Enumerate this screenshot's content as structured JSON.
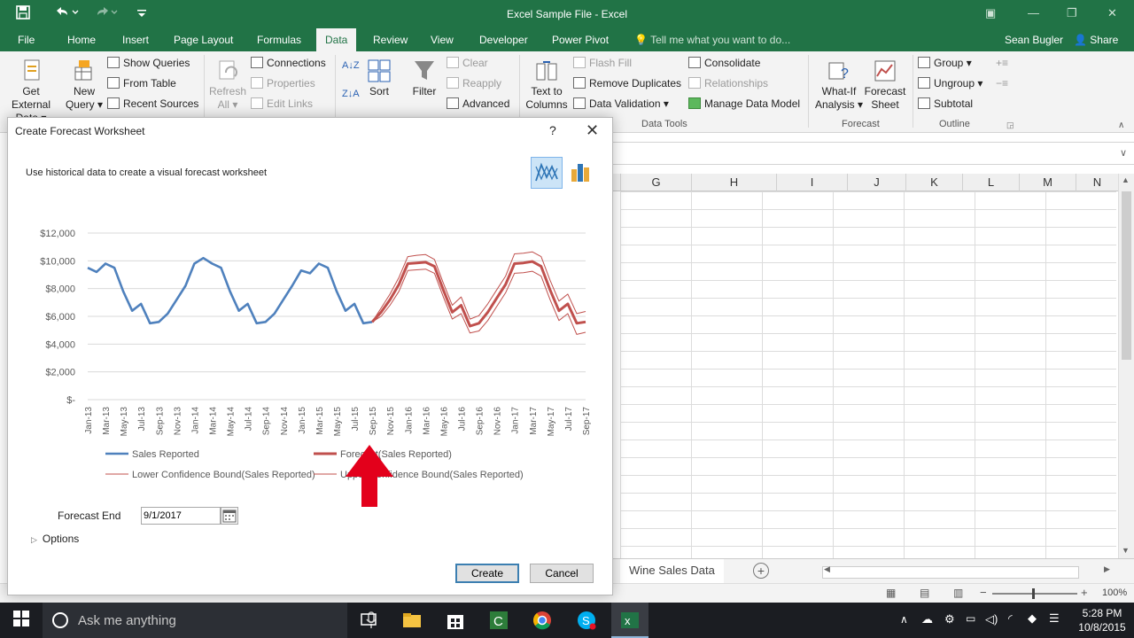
{
  "window": {
    "title": "Excel Sample File - Excel"
  },
  "tabs": [
    {
      "label": "File"
    },
    {
      "label": "Home"
    },
    {
      "label": "Insert"
    },
    {
      "label": "Page Layout"
    },
    {
      "label": "Formulas"
    },
    {
      "label": "Data"
    },
    {
      "label": "Review"
    },
    {
      "label": "View"
    },
    {
      "label": "Developer"
    },
    {
      "label": "Power Pivot"
    }
  ],
  "tell_me": "Tell me what you want to do...",
  "user": "Sean Bugler",
  "share": "Share",
  "ribbon": {
    "get_external": "Get External",
    "get_external_2": "Data",
    "new_query": "New",
    "new_query_2": "Query",
    "show_queries": "Show Queries",
    "from_table": "From Table",
    "recent_sources": "Recent Sources",
    "refresh": "Refresh",
    "refresh_2": "All",
    "connections": "Connections",
    "properties": "Properties",
    "edit_links": "Edit Links",
    "sort": "Sort",
    "filter": "Filter",
    "clear": "Clear",
    "reapply": "Reapply",
    "advanced": "Advanced",
    "text_to_columns": "Text to",
    "text_to_columns_2": "Columns",
    "flash_fill": "Flash Fill",
    "remove_duplicates": "Remove Duplicates",
    "data_validation": "Data Validation",
    "consolidate": "Consolidate",
    "relationships": "Relationships",
    "manage_data_model": "Manage Data Model",
    "data_tools_group": "Data Tools",
    "what_if": "What-If",
    "what_if_2": "Analysis",
    "forecast_sheet": "Forecast",
    "forecast_sheet_2": "Sheet",
    "forecast_group": "Forecast",
    "group": "Group",
    "ungroup": "Ungroup",
    "subtotal": "Subtotal",
    "outline_group": "Outline"
  },
  "sheet": {
    "columns": [
      "G",
      "H",
      "I",
      "J",
      "K",
      "L",
      "M",
      "N"
    ],
    "tab_name": "Wine Sales Data",
    "zoom": "100%"
  },
  "dialog": {
    "title": "Create Forecast Worksheet",
    "help": "?",
    "subtitle": "Use historical data to create a visual forecast worksheet",
    "forecast_end_label": "Forecast End",
    "forecast_end_value": "9/1/2017",
    "options_label": "Options",
    "create_button": "Create",
    "cancel_button": "Cancel"
  },
  "chart_data": {
    "type": "line",
    "ylim": [
      0,
      12000
    ],
    "y_ticks": [
      "$-",
      "$2,000",
      "$4,000",
      "$6,000",
      "$8,000",
      "$10,000",
      "$12,000"
    ],
    "x": [
      "Jan-13",
      "Feb-13",
      "Mar-13",
      "Apr-13",
      "May-13",
      "Jun-13",
      "Jul-13",
      "Aug-13",
      "Sep-13",
      "Oct-13",
      "Nov-13",
      "Dec-13",
      "Jan-14",
      "Feb-14",
      "Mar-14",
      "Apr-14",
      "May-14",
      "Jun-14",
      "Jul-14",
      "Aug-14",
      "Sep-14",
      "Oct-14",
      "Nov-14",
      "Dec-14",
      "Jan-15",
      "Feb-15",
      "Mar-15",
      "Apr-15",
      "May-15",
      "Jun-15",
      "Jul-15",
      "Aug-15",
      "Sep-15",
      "Oct-15",
      "Nov-15",
      "Dec-15",
      "Jan-16",
      "Feb-16",
      "Mar-16",
      "Apr-16",
      "May-16",
      "Jun-16",
      "Jul-16",
      "Aug-16",
      "Sep-16",
      "Oct-16",
      "Nov-16",
      "Dec-16",
      "Jan-17",
      "Feb-17",
      "Mar-17",
      "Apr-17",
      "May-17",
      "Jun-17",
      "Jul-17",
      "Aug-17",
      "Sep-17"
    ],
    "tick_labels": [
      "Jan-13",
      "Mar-13",
      "May-13",
      "Jul-13",
      "Sep-13",
      "Nov-13",
      "Jan-14",
      "Mar-14",
      "May-14",
      "Jul-14",
      "Sep-14",
      "Nov-14",
      "Jan-15",
      "Mar-15",
      "May-15",
      "Jul-15",
      "Sep-15",
      "Nov-15",
      "Jan-16",
      "Mar-16",
      "May-16",
      "Jul-16",
      "Sep-16",
      "Nov-16",
      "Jan-17",
      "Mar-17",
      "May-17",
      "Jul-17",
      "Sep-17"
    ],
    "series": [
      {
        "name": "Sales Reported",
        "color": "#4f81bd",
        "values": [
          9500,
          9200,
          9800,
          9500,
          7800,
          6400,
          6900,
          5500,
          5600,
          6200,
          7200,
          8200,
          9800,
          10200,
          9800,
          9500,
          7800,
          6400,
          6900,
          5500,
          5600,
          6200,
          7200,
          8200,
          9300,
          9100,
          9800,
          9500,
          7800,
          6400,
          6900,
          5500,
          5600,
          null,
          null,
          null,
          null,
          null,
          null,
          null,
          null,
          null,
          null,
          null,
          null,
          null,
          null,
          null,
          null,
          null,
          null,
          null,
          null,
          null,
          null,
          null,
          null
        ]
      },
      {
        "name": "Forecast(Sales Reported)",
        "color": "#c0504d",
        "values": [
          null,
          null,
          null,
          null,
          null,
          null,
          null,
          null,
          null,
          null,
          null,
          null,
          null,
          null,
          null,
          null,
          null,
          null,
          null,
          null,
          null,
          null,
          null,
          null,
          null,
          null,
          null,
          null,
          null,
          null,
          null,
          null,
          5600,
          6300,
          7200,
          8300,
          9800,
          9850,
          9900,
          9600,
          7900,
          6300,
          6800,
          5300,
          5500,
          6300,
          7300,
          8300,
          9800,
          9850,
          9950,
          9600,
          7900,
          6400,
          6900,
          5500,
          5600
        ]
      },
      {
        "name": "Lower Confidence Bound(Sales Reported)",
        "color": "#c0504d",
        "values": [
          null,
          null,
          null,
          null,
          null,
          null,
          null,
          null,
          null,
          null,
          null,
          null,
          null,
          null,
          null,
          null,
          null,
          null,
          null,
          null,
          null,
          null,
          null,
          null,
          null,
          null,
          null,
          null,
          null,
          null,
          null,
          null,
          5600,
          6000,
          6800,
          7800,
          9300,
          9350,
          9400,
          9100,
          7400,
          5800,
          6200,
          4800,
          4950,
          5700,
          6700,
          7700,
          9100,
          9150,
          9250,
          8900,
          7200,
          5700,
          6200,
          4700,
          4850
        ]
      },
      {
        "name": "Upper Confidence Bound(Sales Reported)",
        "color": "#c0504d",
        "values": [
          null,
          null,
          null,
          null,
          null,
          null,
          null,
          null,
          null,
          null,
          null,
          null,
          null,
          null,
          null,
          null,
          null,
          null,
          null,
          null,
          null,
          null,
          null,
          null,
          null,
          null,
          null,
          null,
          null,
          null,
          null,
          null,
          5600,
          6600,
          7600,
          8800,
          10300,
          10400,
          10450,
          10100,
          8400,
          6800,
          7400,
          5800,
          6050,
          6900,
          7900,
          8900,
          10500,
          10550,
          10650,
          10300,
          8600,
          7100,
          7600,
          6200,
          6350
        ]
      }
    ],
    "legend": "bottom"
  },
  "taskbar": {
    "search_placeholder": "Ask me anything",
    "time": "5:28 PM",
    "date": "10/8/2015"
  }
}
